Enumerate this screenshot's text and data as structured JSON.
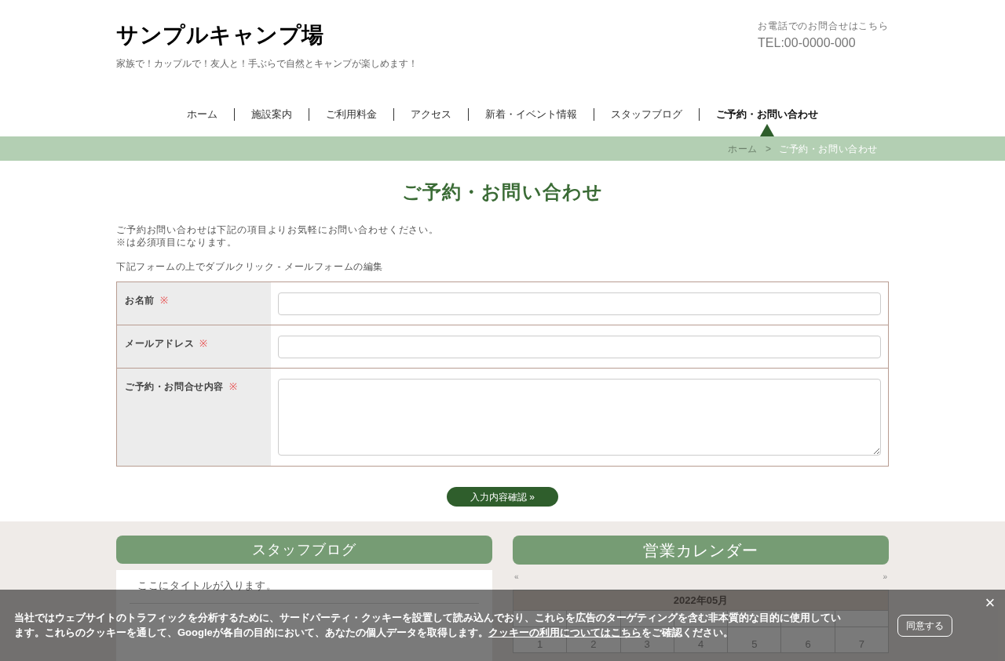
{
  "header": {
    "site_title": "サンプルキャンプ場",
    "tagline": "家族で！カップルで！友人と！手ぶらで自然とキャンプが楽しめます！",
    "contact_label": "お電話でのお問合せはこちら",
    "phone": "TEL:00-0000-000"
  },
  "nav": [
    {
      "label": "ホーム",
      "selected": false
    },
    {
      "label": "施設案内",
      "selected": false
    },
    {
      "label": "ご利用料金",
      "selected": false
    },
    {
      "label": "アクセス",
      "selected": false
    },
    {
      "label": "新着・イベント情報",
      "selected": false
    },
    {
      "label": "スタッフブログ",
      "selected": false
    },
    {
      "label": "ご予約・お問い合わせ",
      "selected": true
    }
  ],
  "breadcrumb": {
    "separator": ">",
    "items": [
      {
        "label": "ホーム",
        "current": false
      },
      {
        "label": "ご予約・お問い合わせ",
        "current": true
      }
    ]
  },
  "page": {
    "title": "ご予約・お問い合わせ",
    "intro": [
      "ご予約お問い合わせは下記の項目よりお気軽にお問い合わせください。",
      "※は必須項目になります。"
    ],
    "edit_hint": "下記フォームの上でダブルクリック - メールフォームの編集"
  },
  "form": {
    "fields": [
      {
        "label": "お名前",
        "mark": "※",
        "kind": "input"
      },
      {
        "label": "メールアドレス",
        "mark": "※",
        "kind": "input"
      },
      {
        "label": "ご予約・お問合せ内容",
        "mark": "※",
        "kind": "textarea"
      }
    ],
    "submit": "入力内容確認 »"
  },
  "blog": {
    "heading": "スタッフブログ",
    "post_title": "ここにタイトルが入ります。"
  },
  "calendar": {
    "heading": "営業カレンダー",
    "prev": "«",
    "next": "»",
    "month": "2022年05月",
    "weeks": [
      [
        "1",
        "2",
        "3",
        "4",
        "5",
        "6",
        "7"
      ]
    ]
  },
  "cookie_banner": {
    "text_before": "当社ではウェブサイトのトラフィックを分析するために、サードパーティ・クッキーを設置して読み込んでおり、これらを広告のターゲティングを含む非本質的な目的に使用しています。これらのクッキーを通して、Googleが各自の目的において、あなたの個人データを取得します。",
    "link": "クッキーの利用についてはこちら",
    "text_after": "をご確認ください。",
    "accept": "同意する",
    "close": "×"
  }
}
